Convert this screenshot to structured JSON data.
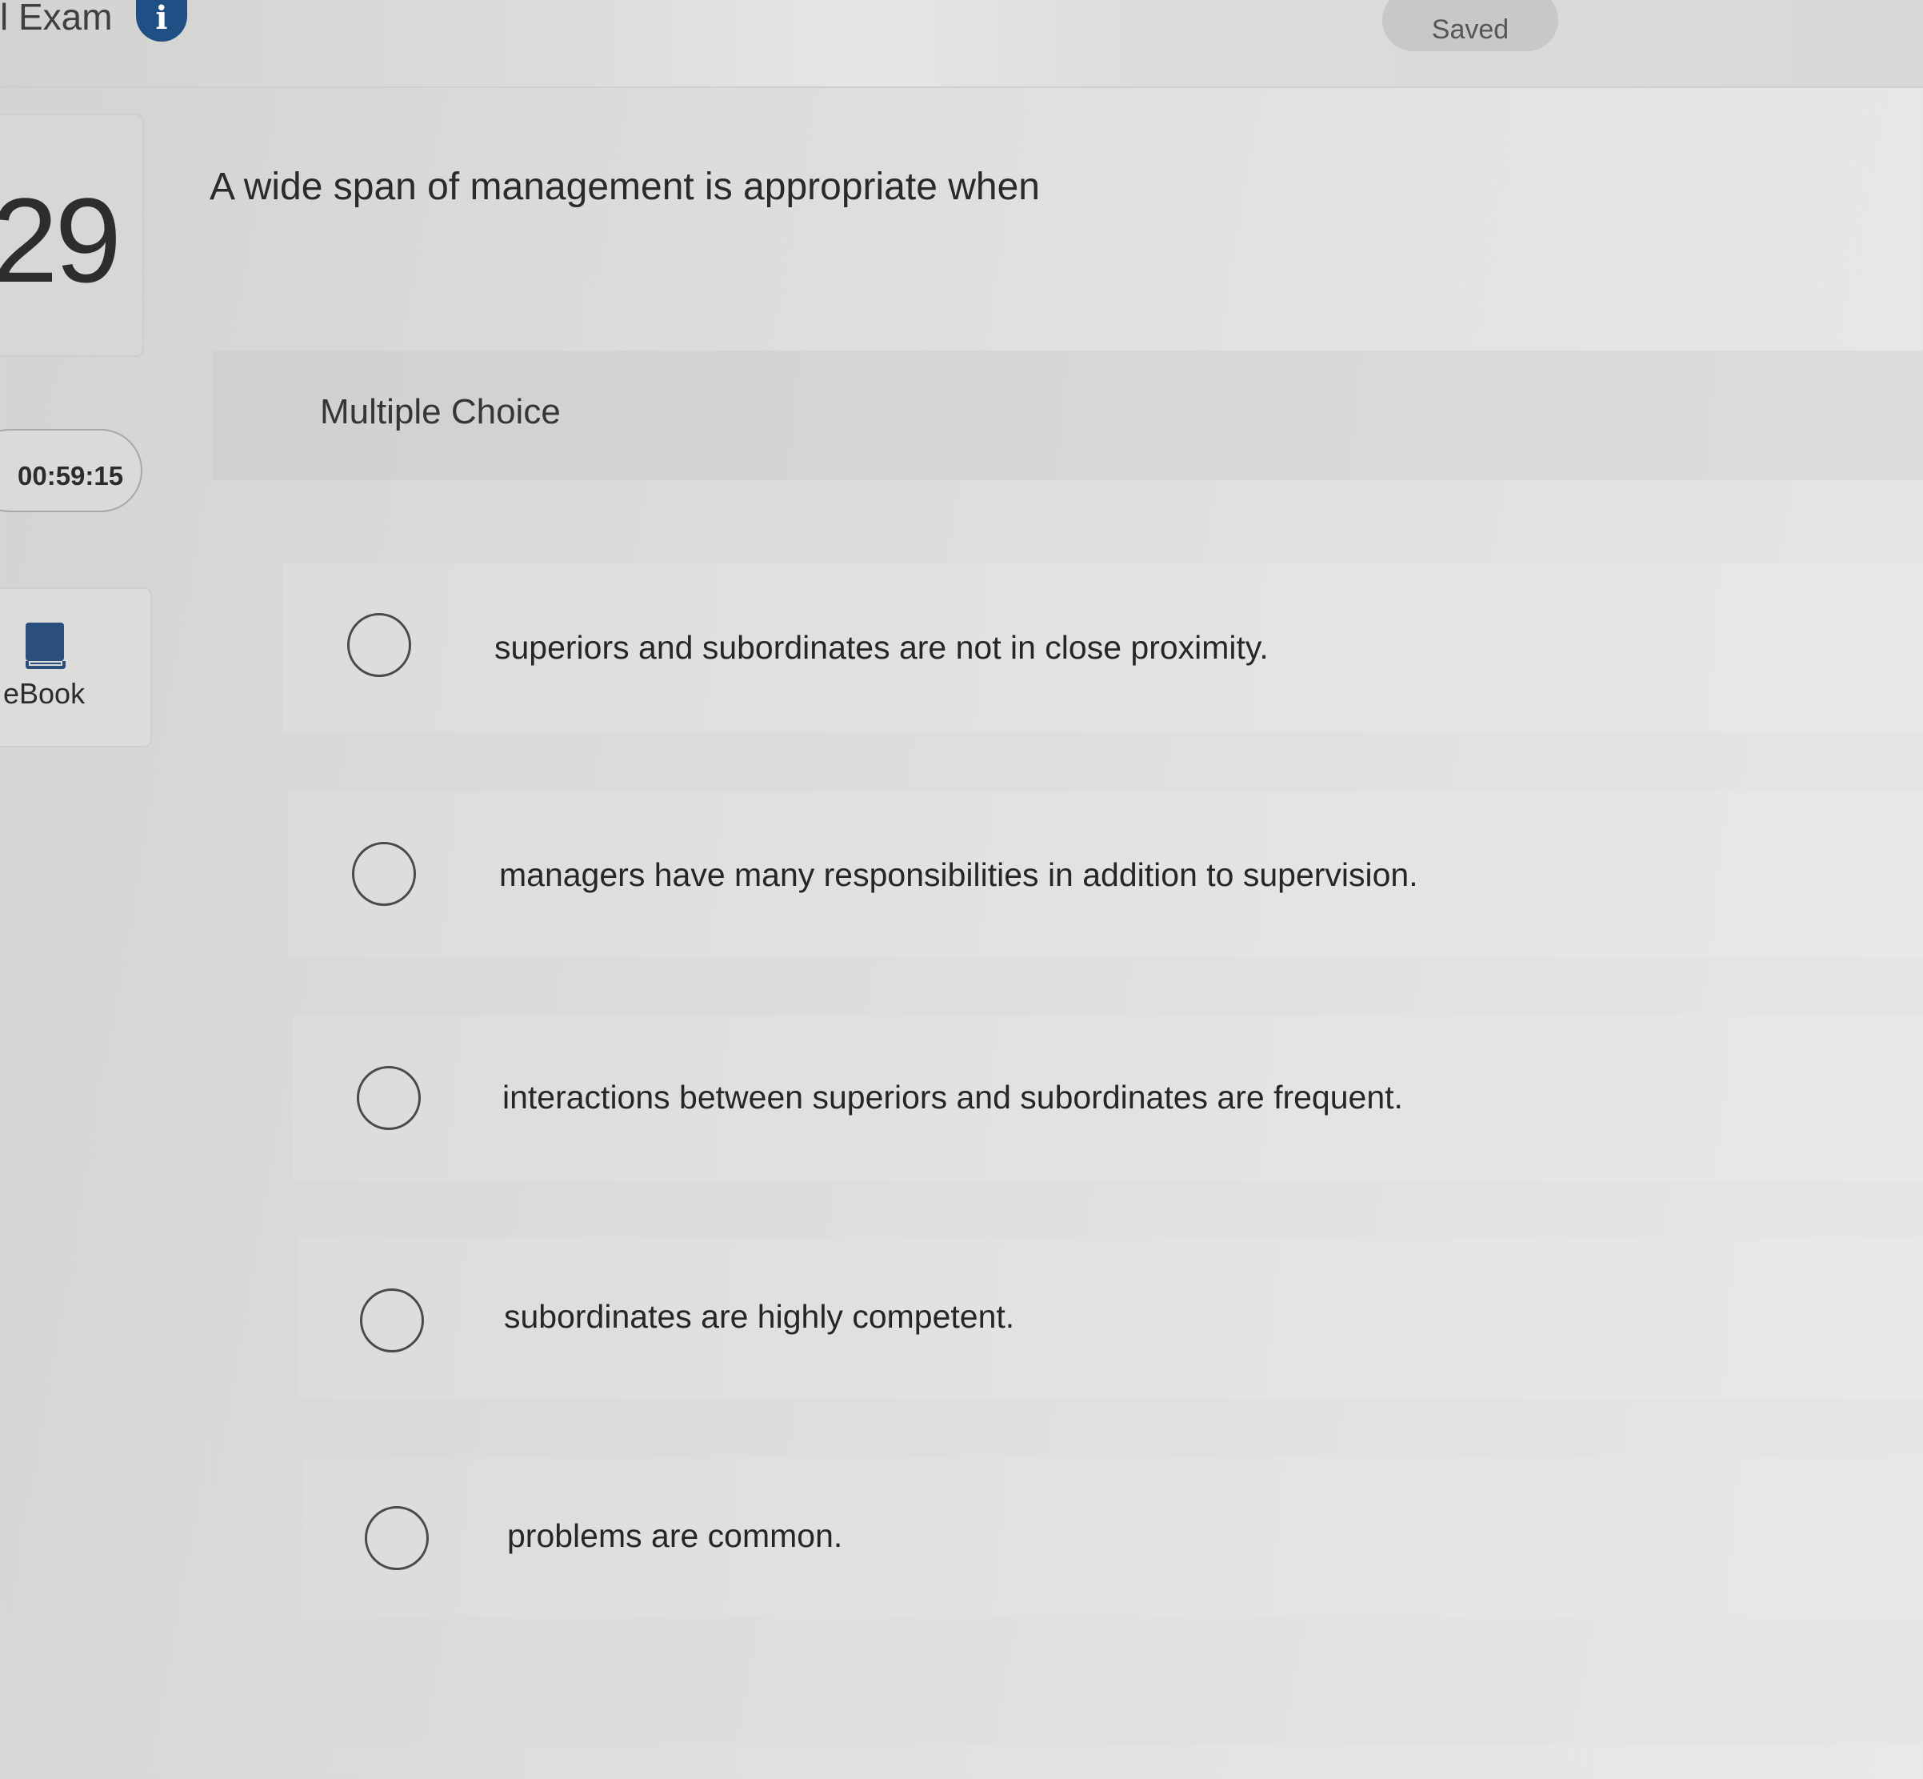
{
  "header": {
    "exam_title": "l Exam",
    "info_icon": "info-icon",
    "status": "Saved"
  },
  "sidebar": {
    "question_number": "29",
    "timer": "00:59:15",
    "ebook_label": "eBook",
    "ebook_icon": "book-icon"
  },
  "question": {
    "prompt": "A wide span of management is appropriate when",
    "type_label": "Multiple Choice",
    "options": [
      {
        "label": "superiors and subordinates are not in close proximity."
      },
      {
        "label": "managers have many responsibilities in addition to supervision."
      },
      {
        "label": "interactions between superiors and subordinates are frequent."
      },
      {
        "label": "subordinates are highly competent."
      },
      {
        "label": "problems are common."
      }
    ]
  },
  "colors": {
    "info_icon": "#1f4f85",
    "book_icon": "#2a4f7d"
  }
}
